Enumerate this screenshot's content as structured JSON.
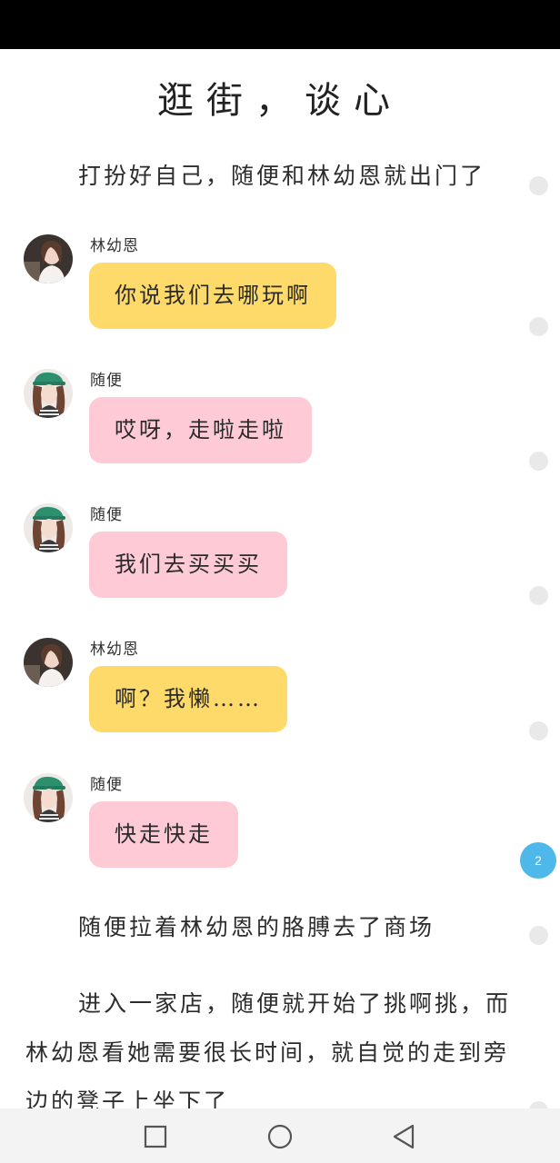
{
  "page": {
    "title": "逛街，谈心"
  },
  "narration": [
    "打扮好自己，随便和林幼恩就出门了",
    "随便拉着林幼恩的胳膊去了商场",
    "进入一家店，随便就开始了挑啊挑，而林幼恩看她需要很长时间，就自觉的走到旁边的凳子上坐下了"
  ],
  "messages": [
    {
      "sender": "林幼恩",
      "text": "你说我们去哪玩啊",
      "bubble_color": "#fdda6a",
      "avatar": "avatar-lin"
    },
    {
      "sender": "随便",
      "text": "哎呀，走啦走啦",
      "bubble_color": "#fdcad6",
      "avatar": "avatar-suibian"
    },
    {
      "sender": "随便",
      "text": "我们去买买买",
      "bubble_color": "#fdcad6",
      "avatar": "avatar-suibian"
    },
    {
      "sender": "林幼恩",
      "text": "啊？我懒……",
      "bubble_color": "#fdda6a",
      "avatar": "avatar-lin"
    },
    {
      "sender": "随便",
      "text": "快走快走",
      "bubble_color": "#fdcad6",
      "avatar": "avatar-suibian"
    }
  ],
  "side": {
    "page_badge": "2",
    "badge_color": "#4db8e9"
  },
  "navigation": {
    "recent_icon": "square-icon",
    "home_icon": "circle-icon",
    "back_icon": "triangle-back-icon"
  }
}
